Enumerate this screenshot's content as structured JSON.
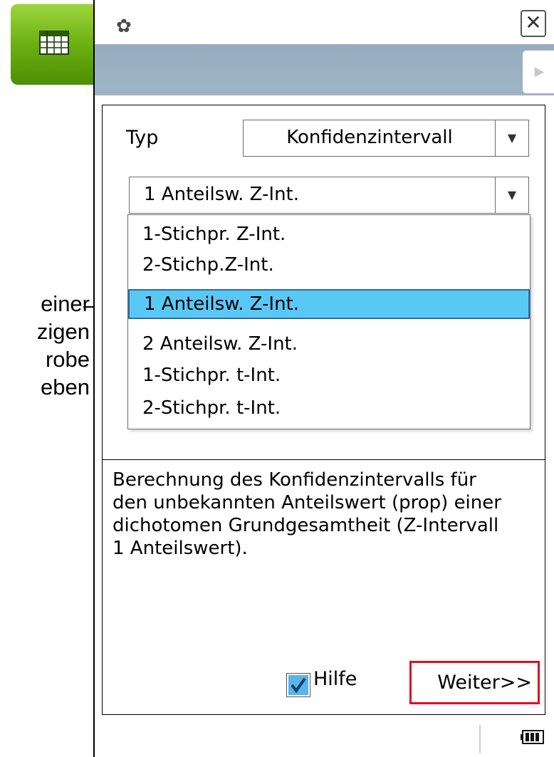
{
  "annotation": {
    "lines": [
      "einer",
      "zigen",
      "robe",
      "eben"
    ]
  },
  "window": {
    "settings_icon": "gear-icon",
    "close_label": "✕",
    "play_label": "▶"
  },
  "dialog": {
    "type_label": "Typ",
    "type_value": "Konfidenzintervall",
    "method_value": "1 Anteilsw. Z-Int.",
    "dropdown_arrow": "▼",
    "options": [
      "1-Stichpr. Z-Int.",
      "2-Stichp.Z-Int.",
      "1 Anteilsw. Z-Int.",
      "2 Anteilsw. Z-Int.",
      "1-Stichpr. t-Int.",
      "2-Stichpr. t-Int."
    ],
    "selected_index": 2,
    "help_text": [
      "Berechnung des Konfidenzintervalls für",
      "den unbekannten Anteilswert (prop) einer",
      "dichotomen Grundgesamtheit (Z-Intervall",
      "1 Anteilswert)."
    ],
    "help_checkbox_label": "Hilfe",
    "help_checked": true,
    "next_label": "Weiter>>"
  },
  "colors": {
    "selection": "#5ac8f5",
    "highlight_border": "#e0101e",
    "header_bar": "#9fb5c7",
    "app_tab": "#6cb012"
  }
}
